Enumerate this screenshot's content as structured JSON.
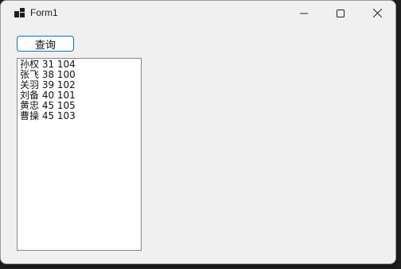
{
  "window": {
    "title": "Form1",
    "icon": "app-form-icon",
    "controls": [
      "minimize-icon",
      "maximize-icon",
      "close-icon"
    ]
  },
  "toolbar": {
    "query_label": "查询"
  },
  "list": {
    "items": [
      "孙权 31 104",
      "张飞 38 100",
      "关羽 39 102",
      "刘备 40 101",
      "黄忠 45 105",
      "曹操 45 103"
    ]
  },
  "colors": {
    "window_bg": "#f0f0f0",
    "button_border": "#0a78c2",
    "list_border": "#828790"
  }
}
